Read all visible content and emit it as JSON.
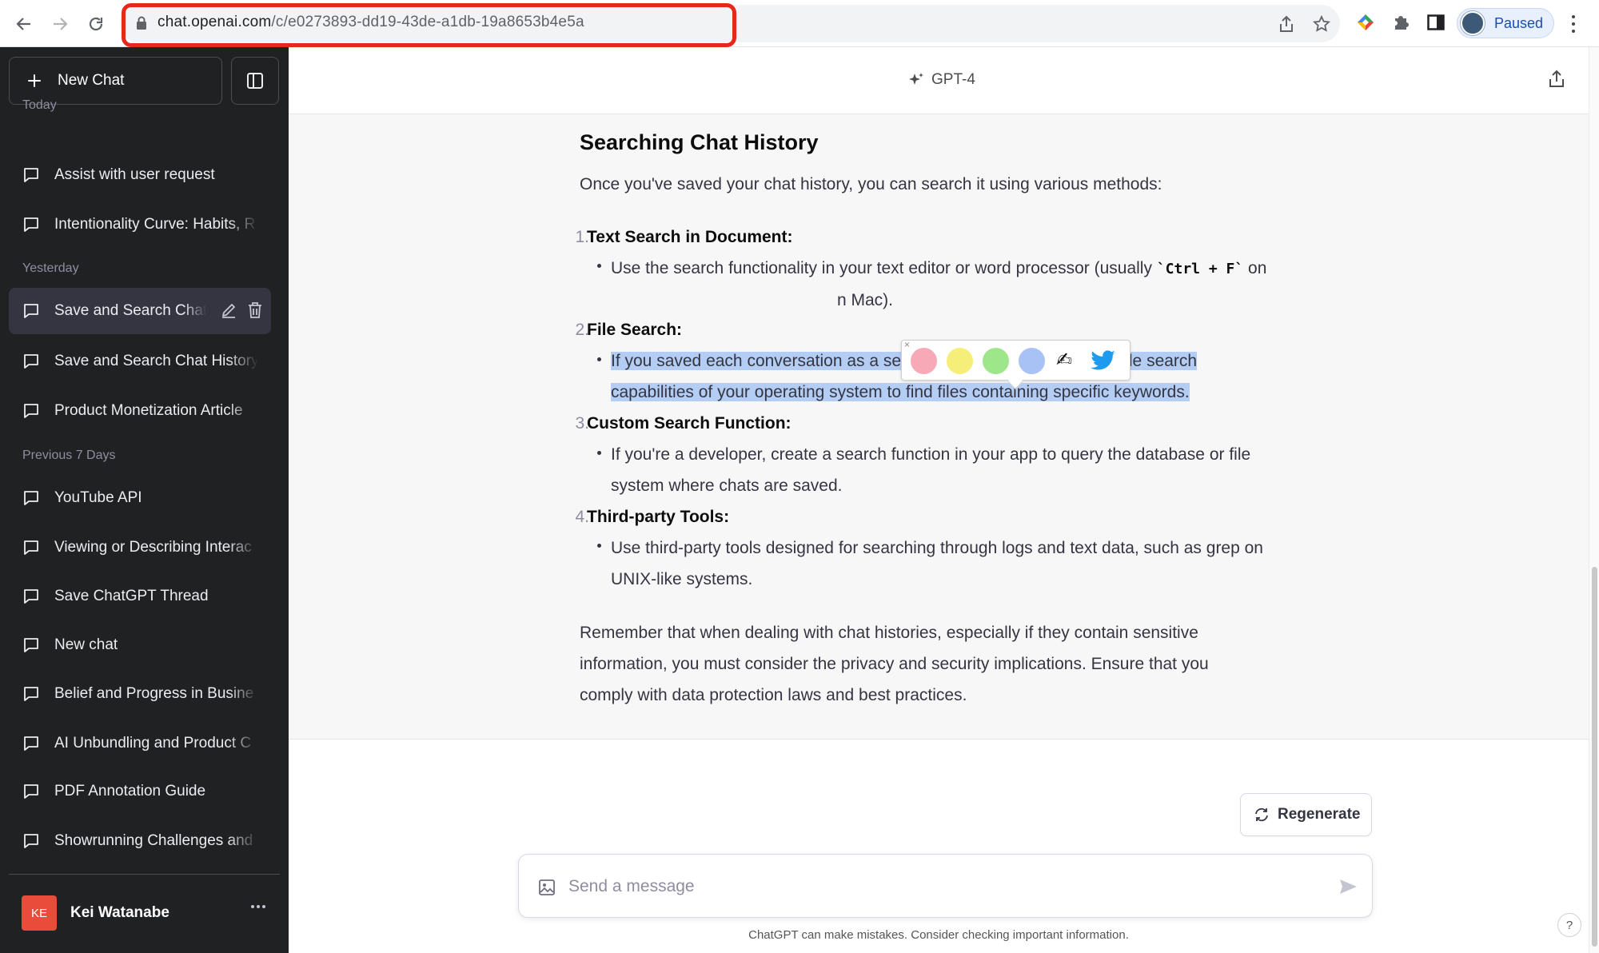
{
  "browser": {
    "url_host": "chat.openai.com",
    "url_path": "/c/e0273893-dd19-43de-a1db-19a8653b4e5a",
    "profile_status": "Paused"
  },
  "sidebar": {
    "new_chat_label": "New Chat",
    "sections": [
      {
        "label": "Today",
        "items": [
          "Assist with user request",
          "Intentionality Curve: Habits, R"
        ]
      },
      {
        "label": "Yesterday",
        "items": [
          "Save and Search Chat",
          "Save and Search Chat History",
          "Product Monetization Article"
        ]
      },
      {
        "label": "Previous 7 Days",
        "items": [
          "YouTube API",
          "Viewing or Describing Interac",
          "Save ChatGPT Thread",
          "New chat",
          "Belief and Progress in Busine",
          "AI Unbundling and Product C",
          "PDF Annotation Guide",
          "Showrunning Challenges and"
        ]
      }
    ],
    "user": {
      "initials": "KE",
      "name": "Kei Watanabe"
    }
  },
  "header": {
    "model": "GPT-4"
  },
  "response": {
    "heading": "Searching Chat History",
    "intro": "Once you've saved your chat history, you can search it using various methods:",
    "items": [
      {
        "num": "1.",
        "title": "Text Search in Document:",
        "line1": "Use the search functionality in your text editor or word processor (usually ",
        "code1": "`Ctrl + F`",
        "line1_end": " on",
        "line2_tail": "n Mac)."
      },
      {
        "num": "2.",
        "title": "File Search:",
        "line1": "If you saved each conversation as a separate file, you could use the file search",
        "line2": "capabilities of your operating system to find files containing specific keywords."
      },
      {
        "num": "3.",
        "title": "Custom Search Function:",
        "line1": "If you're a developer, create a search function in your app to query the database or file",
        "line2": "system where chats are saved."
      },
      {
        "num": "4.",
        "title": "Third-party Tools:",
        "line1": "Use third-party tools designed for searching through logs and text data, such as grep on",
        "line2": "UNIX-like systems."
      }
    ],
    "closing": [
      "Remember that when dealing with chat histories, especially if they contain sensitive",
      "information, you must consider the privacy and security implications. Ensure that you",
      "comply with data protection laws and best practices."
    ]
  },
  "highlight_popup": {
    "colors": [
      "#f7a9b8",
      "#f5ef7a",
      "#9ee68a",
      "#a9c2f5"
    ],
    "pen_glyph": "✍"
  },
  "composer": {
    "regenerate_label": "Regenerate",
    "placeholder": "Send a message",
    "disclaimer": "ChatGPT can make mistakes. Consider checking important information."
  },
  "help_label": "?"
}
